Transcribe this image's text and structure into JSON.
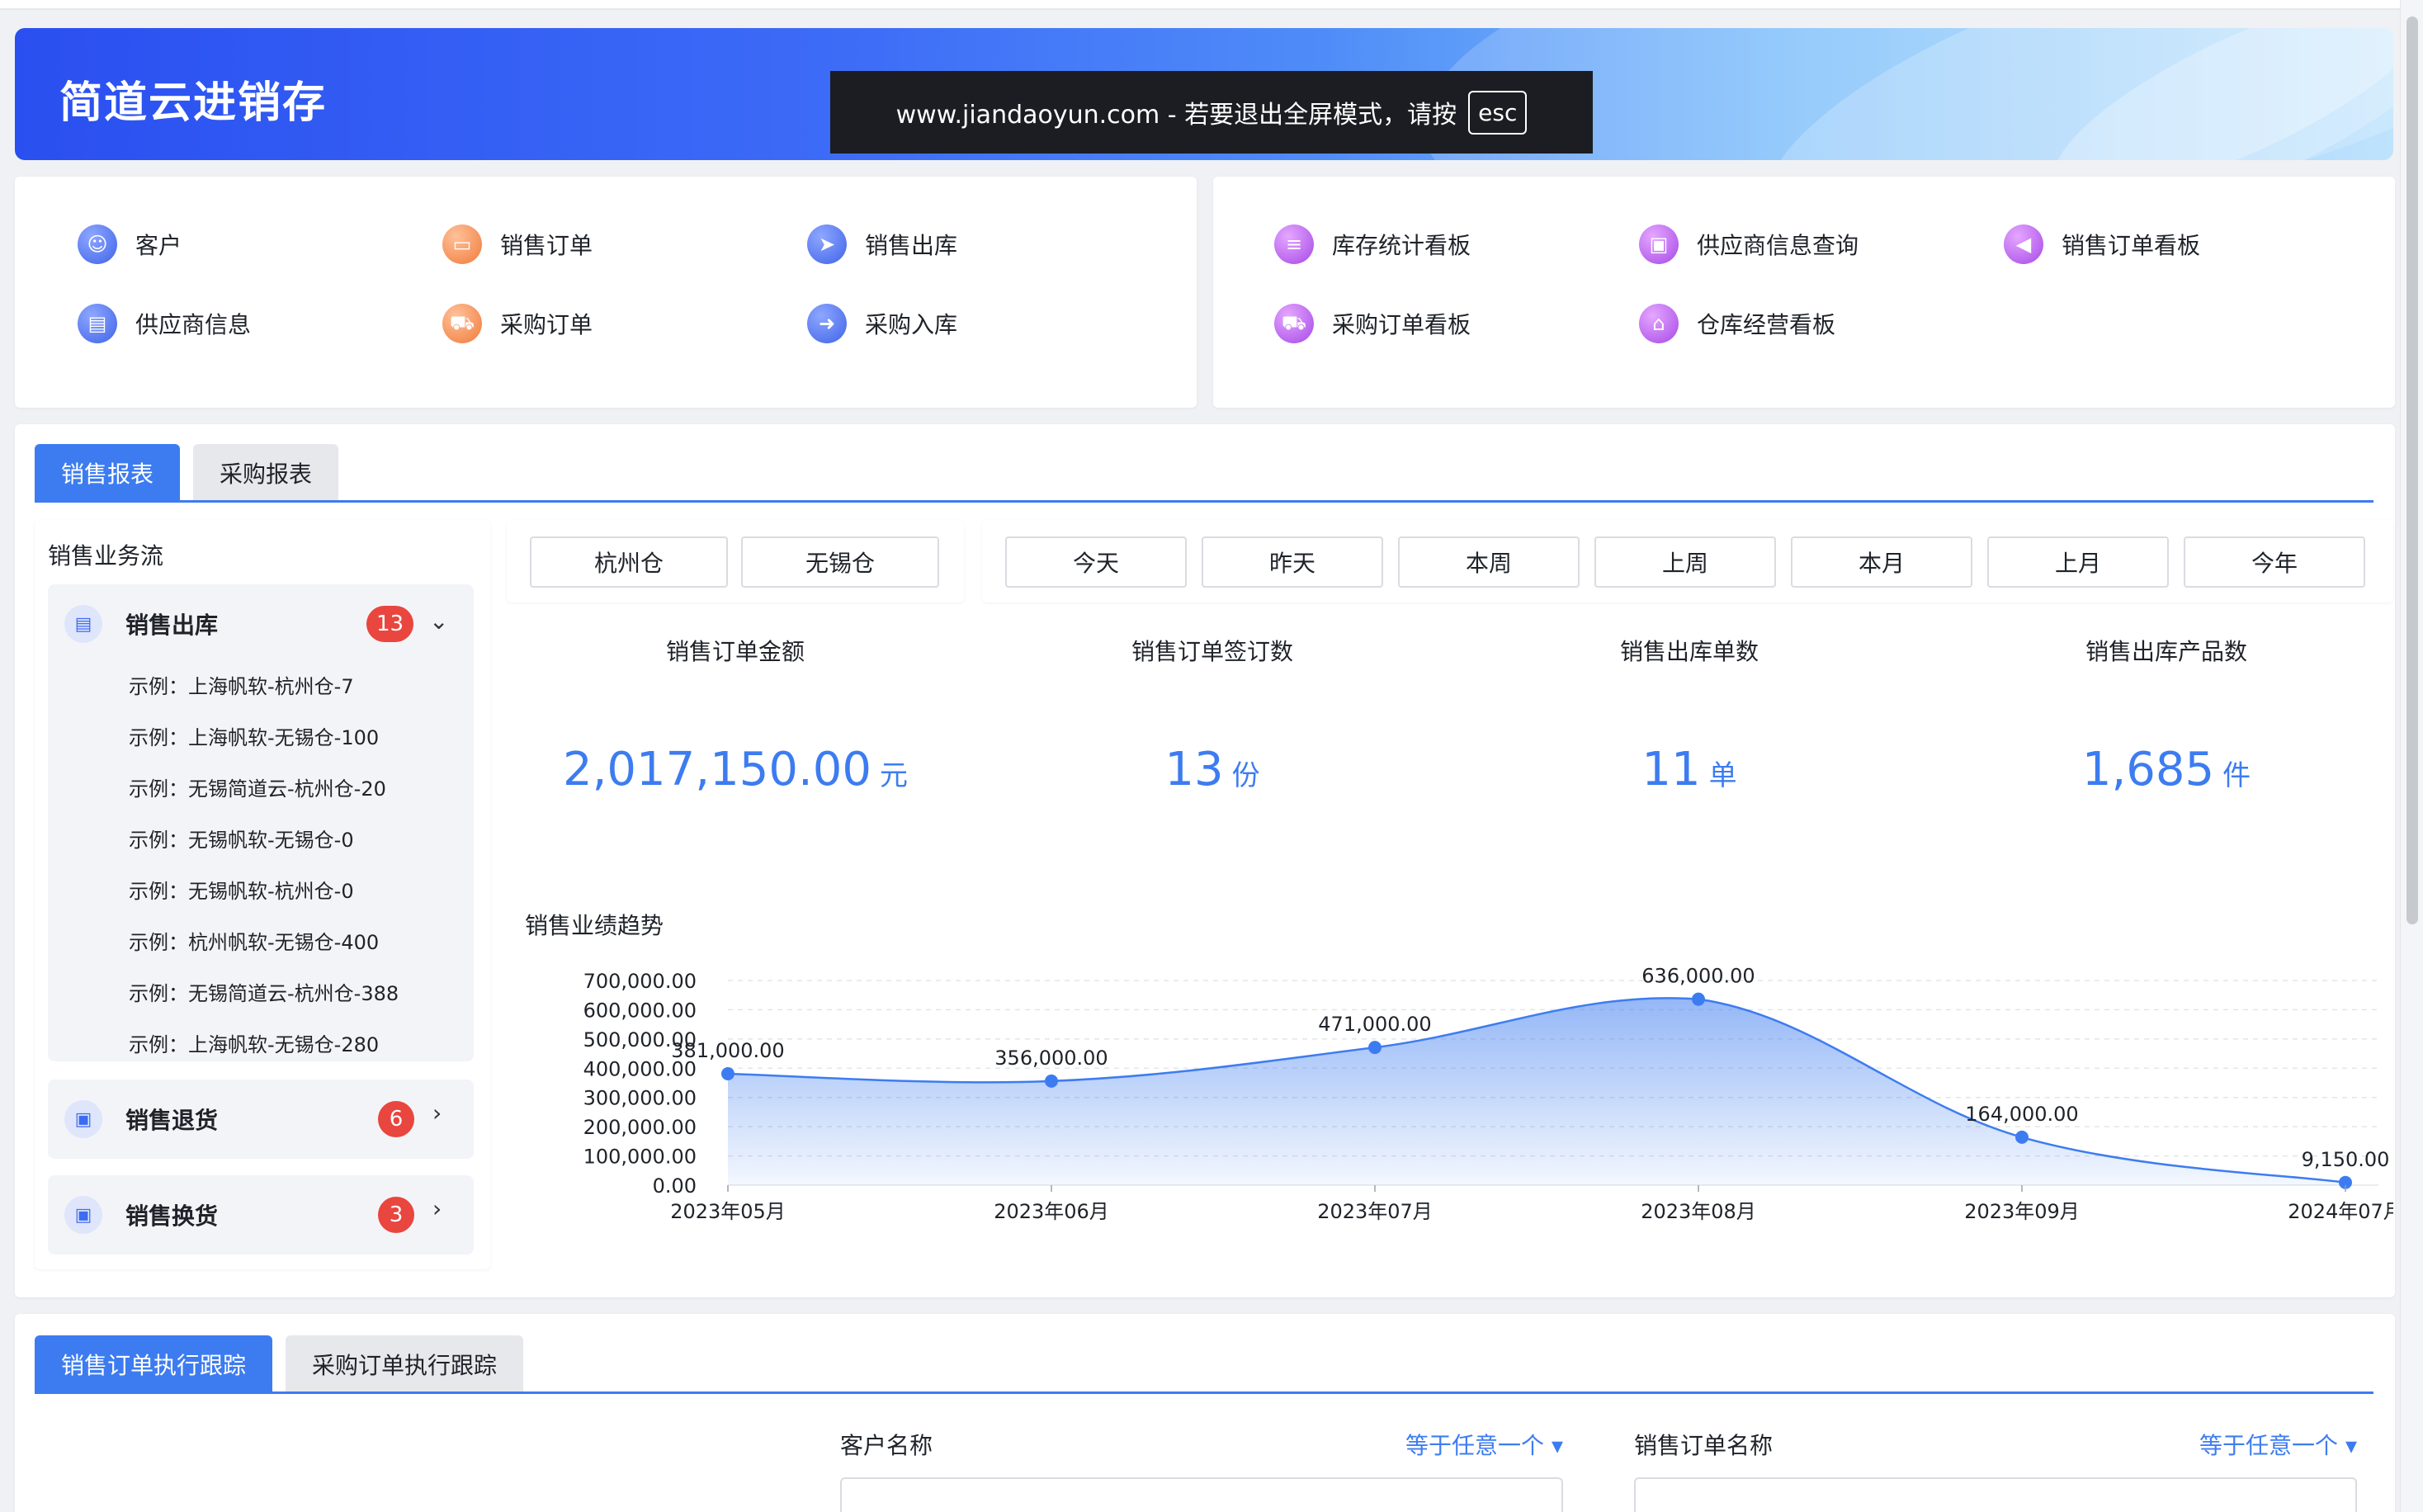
{
  "banner": {
    "title": "简道云进销存",
    "fullscreen_msg": "www.jiandaoyun.com - 若要退出全屏模式，请按",
    "fullscreen_key": "esc"
  },
  "quick_links_left": [
    {
      "label": "客户",
      "icon": "customer-icon"
    },
    {
      "label": "销售订单",
      "icon": "sales-order-icon"
    },
    {
      "label": "销售出库",
      "icon": "send-icon"
    },
    {
      "label": "供应商信息",
      "icon": "supplier-icon"
    },
    {
      "label": "采购订单",
      "icon": "cart-icon"
    },
    {
      "label": "采购入库",
      "icon": "inbound-icon"
    }
  ],
  "quick_links_right": [
    {
      "label": "库存统计看板",
      "icon": "database-icon"
    },
    {
      "label": "供应商信息查询",
      "icon": "briefcase-icon"
    },
    {
      "label": "销售订单看板",
      "icon": "back-arrow-icon"
    },
    {
      "label": "采购订单看板",
      "icon": "truck-icon"
    },
    {
      "label": "仓库经营看板",
      "icon": "warehouse-icon"
    }
  ],
  "report_tabs": [
    "销售报表",
    "采购报表"
  ],
  "sidebar": {
    "title": "销售业务流",
    "groups": [
      {
        "label": "销售出库",
        "count": "13",
        "items": [
          "示例：上海帆软-杭州仓-7",
          "示例：上海帆软-无锡仓-100",
          "示例：无锡简道云-杭州仓-20",
          "示例：无锡帆软-无锡仓-0",
          "示例：无锡帆软-杭州仓-0",
          "示例：杭州帆软-无锡仓-400",
          "示例：无锡简道云-杭州仓-388",
          "示例：上海帆软-无锡仓-280"
        ]
      },
      {
        "label": "销售退货",
        "count": "6"
      },
      {
        "label": "销售换货",
        "count": "3"
      }
    ]
  },
  "warehouses": [
    "杭州仓",
    "无锡仓"
  ],
  "periods": [
    "今天",
    "昨天",
    "本周",
    "上周",
    "本月",
    "上月",
    "今年"
  ],
  "kpis": [
    {
      "title": "销售订单金额",
      "value": "2,017,150.00",
      "unit": "元"
    },
    {
      "title": "销售订单签订数",
      "value": "13",
      "unit": "份"
    },
    {
      "title": "销售出库单数",
      "value": "11",
      "unit": "单"
    },
    {
      "title": "销售出库产品数",
      "value": "1,685",
      "unit": "件"
    }
  ],
  "chart_title": "销售业绩趋势",
  "chart_data": {
    "type": "area",
    "categories": [
      "2023年05月",
      "2023年06月",
      "2023年07月",
      "2023年08月",
      "2023年09月",
      "2024年07月"
    ],
    "values": [
      381000,
      356000,
      471000,
      636000,
      164000,
      9150
    ],
    "value_labels": [
      "381,000.00",
      "356,000.00",
      "471,000.00",
      "636,000.00",
      "164,000.00",
      "9,150.00"
    ],
    "y_ticks": [
      "700,000.00",
      "600,000.00",
      "500,000.00",
      "400,000.00",
      "300,000.00",
      "200,000.00",
      "100,000.00",
      "0.00"
    ],
    "ylim": [
      0,
      700000
    ],
    "grid": true,
    "color": "#3d7cf0"
  },
  "tracking_tabs": [
    "销售订单执行跟踪",
    "采购订单执行跟踪"
  ],
  "filters": [
    {
      "label": "客户名称",
      "op": "等于任意一个"
    },
    {
      "label": "销售订单名称",
      "op": "等于任意一个"
    }
  ],
  "colors": {
    "accent": "#3d7cf0",
    "badge": "#e8463f"
  }
}
